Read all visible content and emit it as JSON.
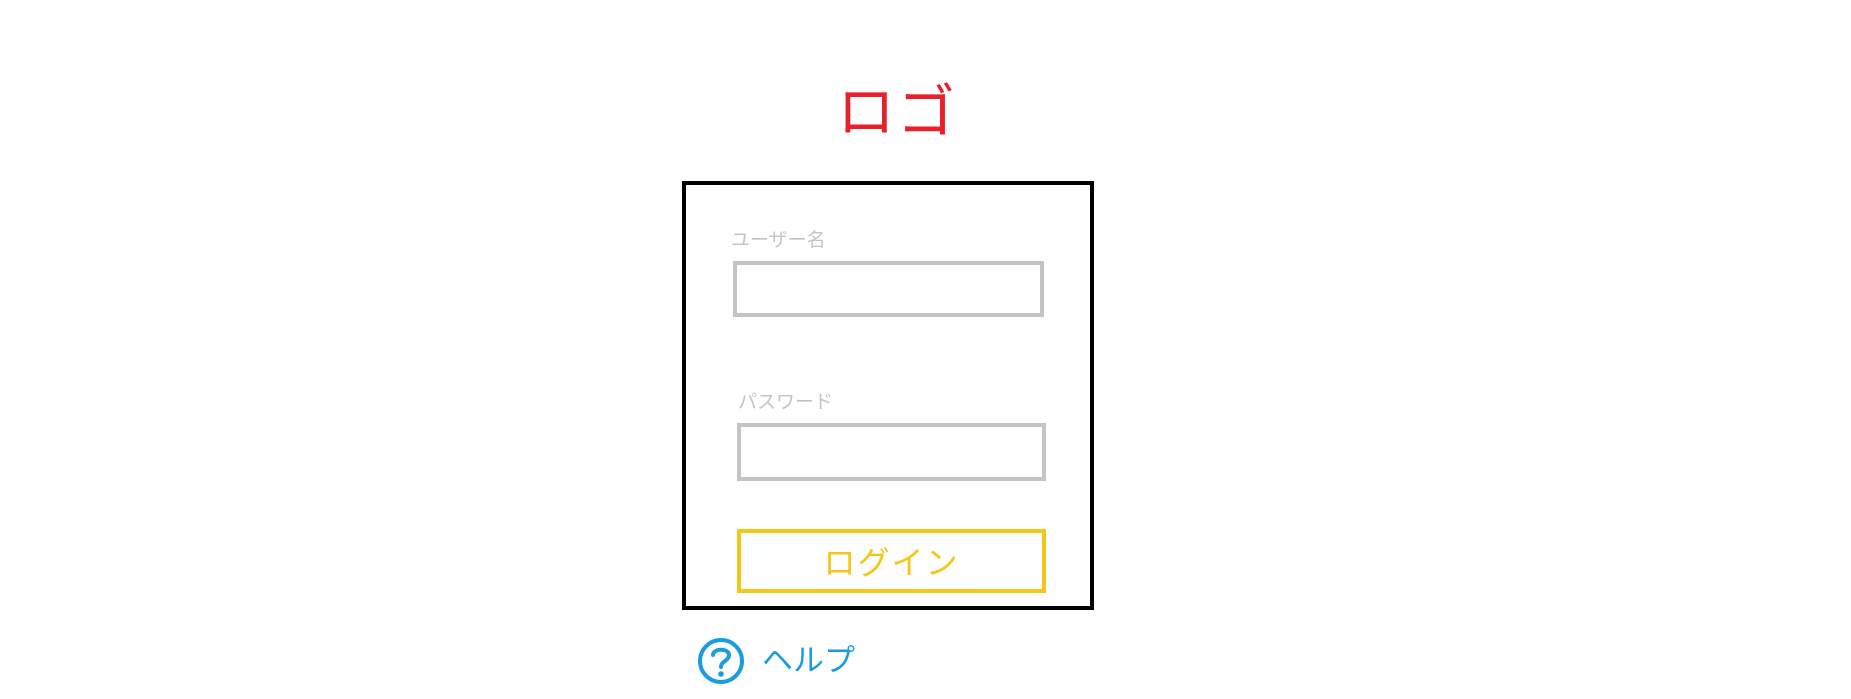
{
  "header": {
    "logo_text": "ロゴ"
  },
  "login_form": {
    "username": {
      "label": "ユーザー名",
      "value": "",
      "placeholder": ""
    },
    "password": {
      "label": "パスワード",
      "value": "",
      "placeholder": ""
    },
    "submit_label": "ログイン"
  },
  "help": {
    "label": "ヘルプ",
    "icon": "help-circle-icon"
  },
  "colors": {
    "logo": "#e8202a",
    "card_border": "#000000",
    "input_border": "#c4c4c4",
    "button_accent": "#f5c518",
    "help": "#1a9de0"
  }
}
